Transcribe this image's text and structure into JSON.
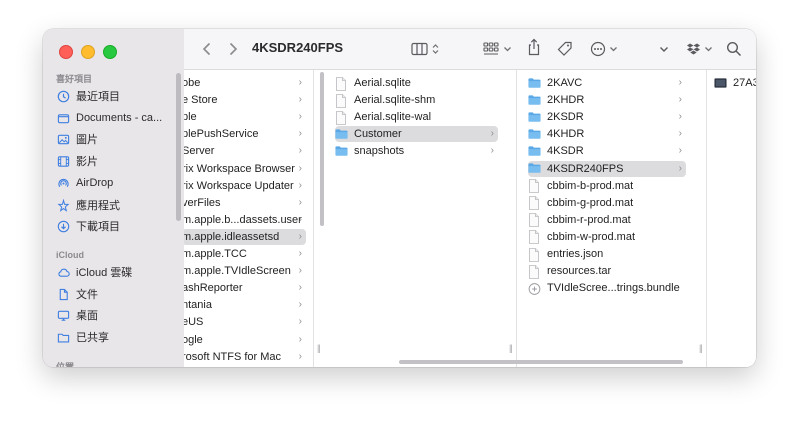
{
  "window": {
    "title": "4KSDR240FPS"
  },
  "sidebar": {
    "favorites_header": "喜好項目",
    "favorites": [
      {
        "label": "最近項目",
        "icon": "clock-icon"
      },
      {
        "label": "Documents - ca...",
        "icon": "documents-icon"
      },
      {
        "label": "圖片",
        "icon": "photo-icon"
      },
      {
        "label": "影片",
        "icon": "film-icon"
      },
      {
        "label": "AirDrop",
        "icon": "airdrop-icon"
      },
      {
        "label": "應用程式",
        "icon": "applications-icon"
      },
      {
        "label": "下載項目",
        "icon": "download-icon"
      }
    ],
    "icloud_header": "iCloud",
    "icloud": [
      {
        "label": "iCloud 雲碟",
        "icon": "cloud-icon"
      },
      {
        "label": "文件",
        "icon": "document-icon"
      },
      {
        "label": "桌面",
        "icon": "desktop-icon"
      },
      {
        "label": "已共享",
        "icon": "shared-folder-icon"
      }
    ],
    "locations_header": "位置"
  },
  "columns": {
    "col1": [
      {
        "label": "obe"
      },
      {
        "label": "e Store"
      },
      {
        "label": "ple"
      },
      {
        "label": "plePushService"
      },
      {
        "label": "Server"
      },
      {
        "label": "rix Workspace Browser"
      },
      {
        "label": "rix Workspace Updater"
      },
      {
        "label": "verFiles"
      },
      {
        "label": "m.apple.b...dassets.user"
      },
      {
        "label": "m.apple.idleassetsd",
        "selected": true
      },
      {
        "label": "m.apple.TCC"
      },
      {
        "label": "m.apple.TVIdleScreen"
      },
      {
        "label": "ashReporter"
      },
      {
        "label": "ntania"
      },
      {
        "label": "eUS"
      },
      {
        "label": "ogle"
      },
      {
        "label": "rosoft NTFS for Mac"
      }
    ],
    "col2": [
      {
        "label": "Aerial.sqlite",
        "type": "file"
      },
      {
        "label": "Aerial.sqlite-shm",
        "type": "file"
      },
      {
        "label": "Aerial.sqlite-wal",
        "type": "file"
      },
      {
        "label": "Customer",
        "type": "folder",
        "selected": true
      },
      {
        "label": "snapshots",
        "type": "folder"
      }
    ],
    "col3": [
      {
        "label": "2KAVC",
        "type": "folder"
      },
      {
        "label": "2KHDR",
        "type": "folder"
      },
      {
        "label": "2KSDR",
        "type": "folder"
      },
      {
        "label": "4KHDR",
        "type": "folder"
      },
      {
        "label": "4KSDR",
        "type": "folder"
      },
      {
        "label": "4KSDR240FPS",
        "type": "folder",
        "selected": true
      },
      {
        "label": "cbbim-b-prod.mat",
        "type": "file"
      },
      {
        "label": "cbbim-g-prod.mat",
        "type": "file"
      },
      {
        "label": "cbbim-r-prod.mat",
        "type": "file"
      },
      {
        "label": "cbbim-w-prod.mat",
        "type": "file"
      },
      {
        "label": "entries.json",
        "type": "file"
      },
      {
        "label": "resources.tar",
        "type": "file"
      },
      {
        "label": "TVIdleScree...trings.bundle",
        "type": "bundle"
      }
    ],
    "col4": [
      {
        "label": "27A3",
        "type": "video"
      }
    ]
  },
  "colors": {
    "folder": "#5aa9e6",
    "accent": "#3f7fe0",
    "selection": "#dcdcde"
  }
}
